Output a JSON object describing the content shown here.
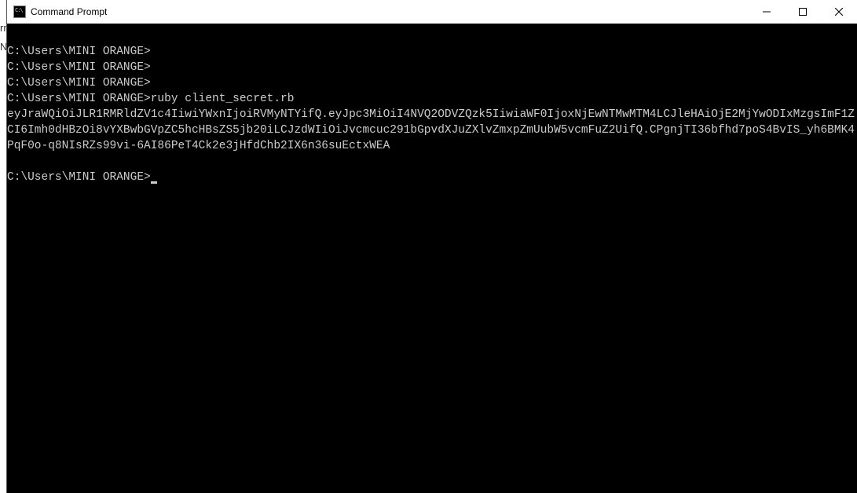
{
  "bg": {
    "line1": "rn",
    "line2": "Nc"
  },
  "window": {
    "title": "Command Prompt"
  },
  "terminal": {
    "lines": [
      "C:\\Users\\MINI ORANGE>",
      "C:\\Users\\MINI ORANGE>",
      "C:\\Users\\MINI ORANGE>",
      "C:\\Users\\MINI ORANGE>ruby client_secret.rb",
      "eyJraWQiOiJLR1RMRldZV1c4IiwiYWxnIjoiRVMyNTYifQ.eyJpc3MiOiI4NVQ2ODVZQzk5IiwiaWF0IjoxNjEwNTMwMTM4LCJleHAiOjE2MjYwODIxMzgsImF1ZCI6Imh0dHBzOi8vYXBwbGVpZC5hcHBsZS5jb20iLCJzdWIiOiJvcmcuc291bGpvdXJuZXlvZmxpZmUubW5vcmFuZ2UifQ.CPgnjTI36bfhd7poS4BvIS_yh6BMK4PqF0o-q8NIsRZs99vi-6AI86PeT4Ck2e3jHfdChb2IX6n36suEctxWEA",
      "",
      "C:\\Users\\MINI ORANGE>"
    ]
  }
}
